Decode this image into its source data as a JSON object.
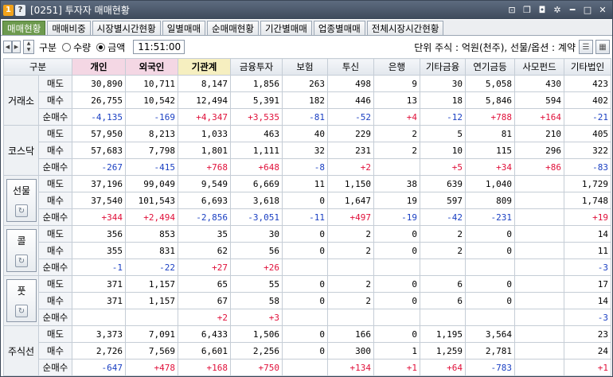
{
  "window": {
    "badge1": "1",
    "badge2": "?",
    "title": "[0251] 투자자 매매현황"
  },
  "tabs": [
    "매매현황",
    "매매비중",
    "시장별시간현황",
    "일별매매",
    "순매매현황",
    "기간별매매",
    "업종별매매",
    "전체시장시간현황"
  ],
  "toolbar": {
    "gubun_label": "구분",
    "radio_qty": "수량",
    "radio_amt": "금액",
    "time": "11:51:00",
    "unit": "단위 주식 : 억원(천주), 선물/옵션 : 계약"
  },
  "headers": [
    "구분",
    "개인",
    "외국인",
    "기관계",
    "금융투자",
    "보험",
    "투신",
    "은행",
    "기타금융",
    "연기금등",
    "사모펀드",
    "기타법인"
  ],
  "groups": [
    {
      "name": "거래소",
      "icon": false,
      "rows": [
        {
          "label": "매도",
          "values": [
            "30,890",
            "10,711",
            "8,147",
            "1,856",
            "263",
            "498",
            "9",
            "30",
            "5,058",
            "430",
            "423"
          ]
        },
        {
          "label": "매수",
          "values": [
            "26,755",
            "10,542",
            "12,494",
            "5,391",
            "182",
            "446",
            "13",
            "18",
            "5,846",
            "594",
            "402"
          ]
        },
        {
          "label": "순매수",
          "values": [
            "-4,135",
            "-169",
            "+4,347",
            "+3,535",
            "-81",
            "-52",
            "+4",
            "-12",
            "+788",
            "+164",
            "-21"
          ]
        }
      ]
    },
    {
      "name": "코스닥",
      "icon": false,
      "rows": [
        {
          "label": "매도",
          "values": [
            "57,950",
            "8,213",
            "1,033",
            "463",
            "40",
            "229",
            "2",
            "5",
            "81",
            "210",
            "405"
          ]
        },
        {
          "label": "매수",
          "values": [
            "57,683",
            "7,798",
            "1,801",
            "1,111",
            "32",
            "231",
            "2",
            "10",
            "115",
            "296",
            "322"
          ]
        },
        {
          "label": "순매수",
          "values": [
            "-267",
            "-415",
            "+768",
            "+648",
            "-8",
            "+2",
            "",
            "+5",
            "+34",
            "+86",
            "-83"
          ]
        }
      ]
    },
    {
      "name": "선물",
      "icon": true,
      "rows": [
        {
          "label": "매도",
          "values": [
            "37,196",
            "99,049",
            "9,549",
            "6,669",
            "11",
            "1,150",
            "38",
            "639",
            "1,040",
            "",
            "1,729"
          ]
        },
        {
          "label": "매수",
          "values": [
            "37,540",
            "101,543",
            "6,693",
            "3,618",
            "0",
            "1,647",
            "19",
            "597",
            "809",
            "",
            "1,748"
          ]
        },
        {
          "label": "순매수",
          "values": [
            "+344",
            "+2,494",
            "-2,856",
            "-3,051",
            "-11",
            "+497",
            "-19",
            "-42",
            "-231",
            "",
            "+19"
          ]
        }
      ]
    },
    {
      "name": "콜",
      "icon": true,
      "rows": [
        {
          "label": "매도",
          "values": [
            "356",
            "853",
            "35",
            "30",
            "0",
            "2",
            "0",
            "2",
            "0",
            "",
            "14"
          ]
        },
        {
          "label": "매수",
          "values": [
            "355",
            "831",
            "62",
            "56",
            "0",
            "2",
            "0",
            "2",
            "0",
            "",
            "11"
          ]
        },
        {
          "label": "순매수",
          "values": [
            "-1",
            "-22",
            "+27",
            "+26",
            "",
            "",
            "",
            "",
            "",
            "",
            "-3"
          ]
        }
      ]
    },
    {
      "name": "풋",
      "icon": true,
      "rows": [
        {
          "label": "매도",
          "values": [
            "371",
            "1,157",
            "65",
            "55",
            "0",
            "2",
            "0",
            "6",
            "0",
            "",
            "17"
          ]
        },
        {
          "label": "매수",
          "values": [
            "371",
            "1,157",
            "67",
            "58",
            "0",
            "2",
            "0",
            "6",
            "0",
            "",
            "14"
          ]
        },
        {
          "label": "순매수",
          "values": [
            "",
            "",
            "+2",
            "+3",
            "",
            "",
            "",
            "",
            "",
            "",
            "-3"
          ]
        }
      ]
    },
    {
      "name": "주식선",
      "icon": false,
      "rows": [
        {
          "label": "매도",
          "values": [
            "3,373",
            "7,091",
            "6,433",
            "1,506",
            "0",
            "166",
            "0",
            "1,195",
            "3,564",
            "",
            "23"
          ]
        },
        {
          "label": "매수",
          "values": [
            "2,726",
            "7,569",
            "6,601",
            "2,256",
            "0",
            "300",
            "1",
            "1,259",
            "2,781",
            "",
            "24"
          ]
        },
        {
          "label": "순매수",
          "values": [
            "-647",
            "+478",
            "+168",
            "+750",
            "",
            "+134",
            "+1",
            "+64",
            "-783",
            "",
            "+1"
          ]
        }
      ]
    }
  ]
}
